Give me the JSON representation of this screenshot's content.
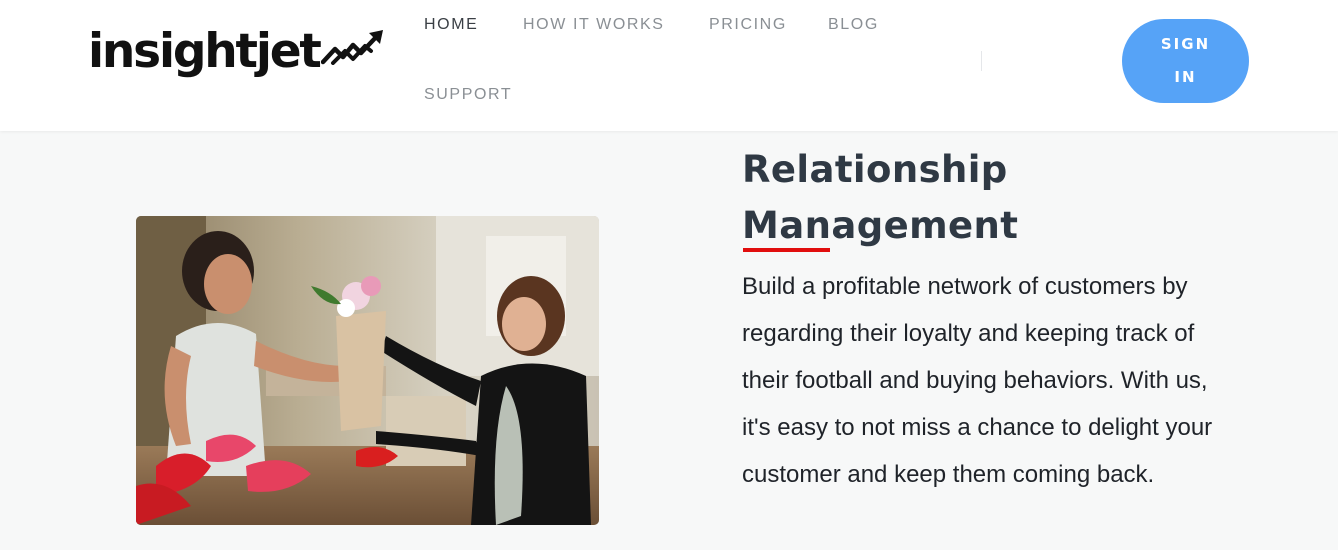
{
  "brand": {
    "name": "insightjet",
    "logo_icon": "trend-arrow-icon"
  },
  "nav": {
    "items": [
      {
        "label": "HOME",
        "active": true
      },
      {
        "label": "HOW IT WORKS",
        "active": false
      },
      {
        "label": "PRICING",
        "active": false
      },
      {
        "label": "BLOG",
        "active": false
      },
      {
        "label": "SUPPORT",
        "active": false
      }
    ]
  },
  "signin": {
    "label": "SIGN IN",
    "color": "#56a3f7"
  },
  "feature": {
    "title_line1": "Relationship",
    "title_line2": "Management",
    "accent_color": "#e10e0e",
    "description": "Build a profitable network of customers by regarding their loyalty and keeping track of their football and buying behaviors. With us, it's easy to not miss a chance to delight your customer and keep them coming back.",
    "image_icon": "florist-handing-bouquet-photo"
  },
  "colors": {
    "heading": "#2f3944",
    "text": "#1f2329",
    "nav": "#8a8f94",
    "nav_active": "#3a3f45",
    "background": "#f7f8f8"
  }
}
